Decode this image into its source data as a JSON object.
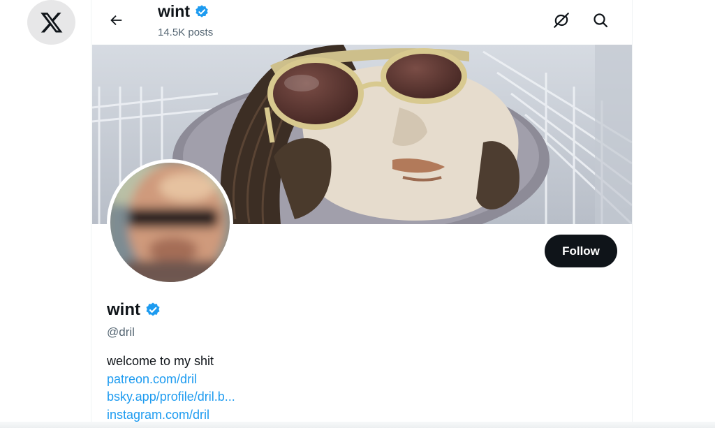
{
  "app": {
    "logo_icon": "x-logo-icon"
  },
  "header": {
    "back_icon": "arrow-left-icon",
    "name": "wint",
    "post_count": "14.5K posts",
    "grok_icon": "grok-icon",
    "search_icon": "search-icon"
  },
  "profile": {
    "display_name": "wint",
    "verified": true,
    "handle": "@dril",
    "follow_label": "Follow",
    "bio": "welcome to my shit",
    "links": [
      "patreon.com/dril",
      "bsky.app/profile/dril.b...",
      "instagram.com/dril"
    ]
  },
  "colors": {
    "accent": "#1d9bf0",
    "text": "#0f1419",
    "secondary": "#536471",
    "button": "#0f1419"
  }
}
